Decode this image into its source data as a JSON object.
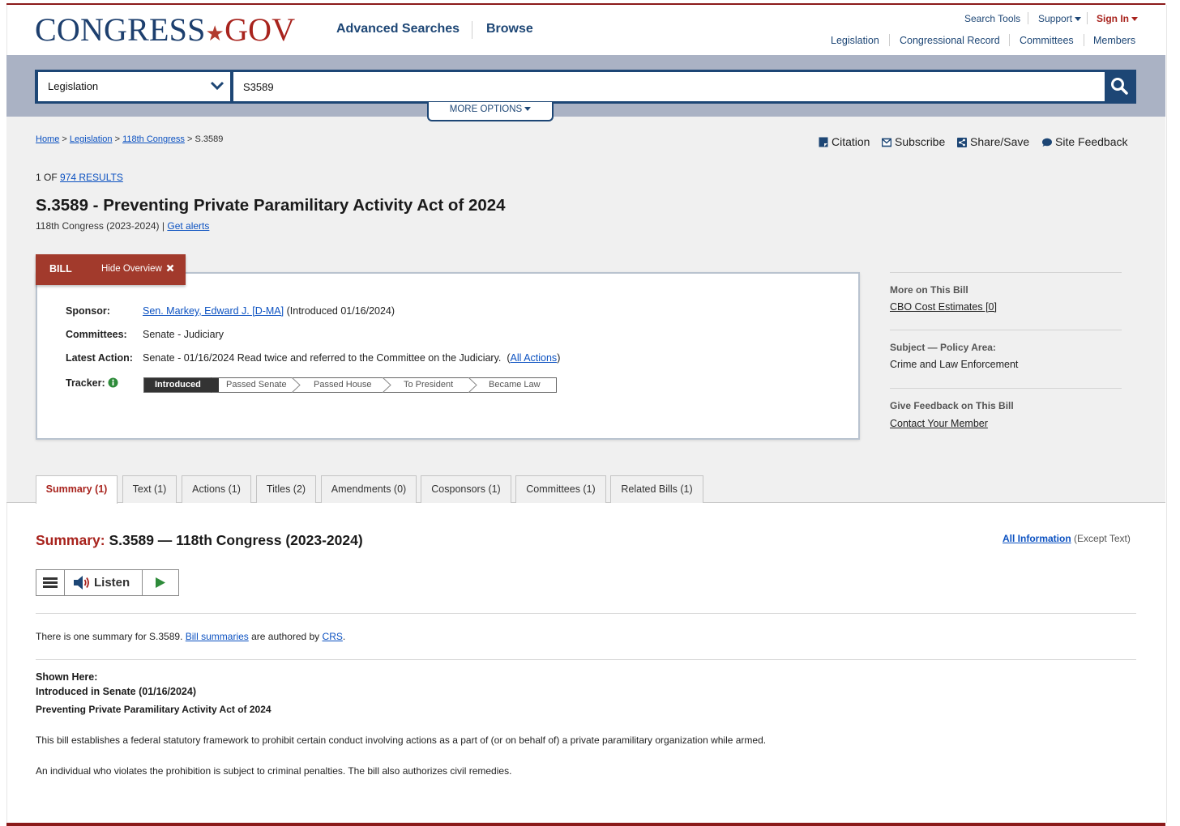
{
  "header": {
    "logo_main": "CONGRESS",
    "logo_dot": "★",
    "logo_gov": "GOV",
    "nav": [
      "Advanced Searches",
      "Browse"
    ],
    "utility": [
      "Search Tools",
      "Support",
      "Sign In"
    ],
    "quick_links": [
      "Legislation",
      "Congressional Record",
      "Committees",
      "Members"
    ]
  },
  "search": {
    "collection": "Legislation",
    "query": "S3589",
    "more_options": "MORE OPTIONS"
  },
  "breadcrumb": {
    "home": "Home",
    "legislation": "Legislation",
    "congress": "118th Congress",
    "sep": ">",
    "current": "S.3589"
  },
  "tools": [
    "Citation",
    "Subscribe",
    "Share/Save",
    "Site Feedback"
  ],
  "results": {
    "prefix": "1 OF",
    "link": "974 RESULTS"
  },
  "bill": {
    "title": "S.3589 - Preventing Private Paramilitary Activity Act of 2024",
    "congress": "118th Congress (2023-2024)",
    "divider": "|",
    "get_alerts": "Get alerts"
  },
  "overview": {
    "tab_label": "BILL",
    "hide_label": "Hide Overview",
    "sponsor_label": "Sponsor:",
    "sponsor_link": "Sen. Markey, Edward J. [D-MA]",
    "sponsor_intro": "(Introduced 01/16/2024)",
    "committees_label": "Committees:",
    "committees_value": "Senate - Judiciary",
    "latest_label": "Latest Action:",
    "latest_value": "Senate - 01/16/2024 Read twice and referred to the Committee on the Judiciary.",
    "all_actions": "All Actions",
    "paren_open": "(",
    "paren_close": ")",
    "tracker_label": "Tracker:",
    "tracker_steps": [
      "Introduced",
      "Passed Senate",
      "Passed House",
      "To President",
      "Became Law"
    ],
    "tracker_current": 0
  },
  "sidebar": [
    {
      "heading": "More on This Bill",
      "value": "CBO Cost Estimates [0]",
      "is_link": true
    },
    {
      "heading": "Subject — Policy Area:",
      "value": "Crime and Law Enforcement",
      "is_link": false
    },
    {
      "heading": "Give Feedback on This Bill",
      "value": "Contact Your Member",
      "is_link": true
    }
  ],
  "tabs": [
    "Summary (1)",
    "Text (1)",
    "Actions (1)",
    "Titles (2)",
    "Amendments (0)",
    "Cosponsors (1)",
    "Committees (1)",
    "Related Bills (1)"
  ],
  "summary": {
    "heading_prefix": "Summary:",
    "heading_rest": "S.3589 — 118th Congress (2023-2024)",
    "all_info": "All Information",
    "all_info_suffix": "(Except Text)",
    "listen": "Listen",
    "one_summary_prefix": "There is one summary for S.3589.",
    "bill_summaries": "Bill summaries",
    "authored_by": "are authored by",
    "crs": "CRS",
    "period": ".",
    "shown_here": "Shown Here:",
    "introduced_in": "Introduced in Senate (01/16/2024)",
    "act_title": "Preventing Private Paramilitary Activity Act of 2024",
    "para1": "This bill establishes a federal statutory framework to prohibit certain conduct involving actions as a part of (or on behalf of) a private paramilitary organization while armed.",
    "para2": "An individual who violates the prohibition is subject to criminal penalties. The bill also authorizes civil remedies."
  },
  "colors": {
    "navy": "#1d4675",
    "maroon": "#a8231d",
    "bill_tab": "#a23a2c",
    "link": "#0b51c1",
    "tracker_active": "#333333",
    "info_icon": "#2e8b3a",
    "play_icon": "#2e8b3a"
  }
}
